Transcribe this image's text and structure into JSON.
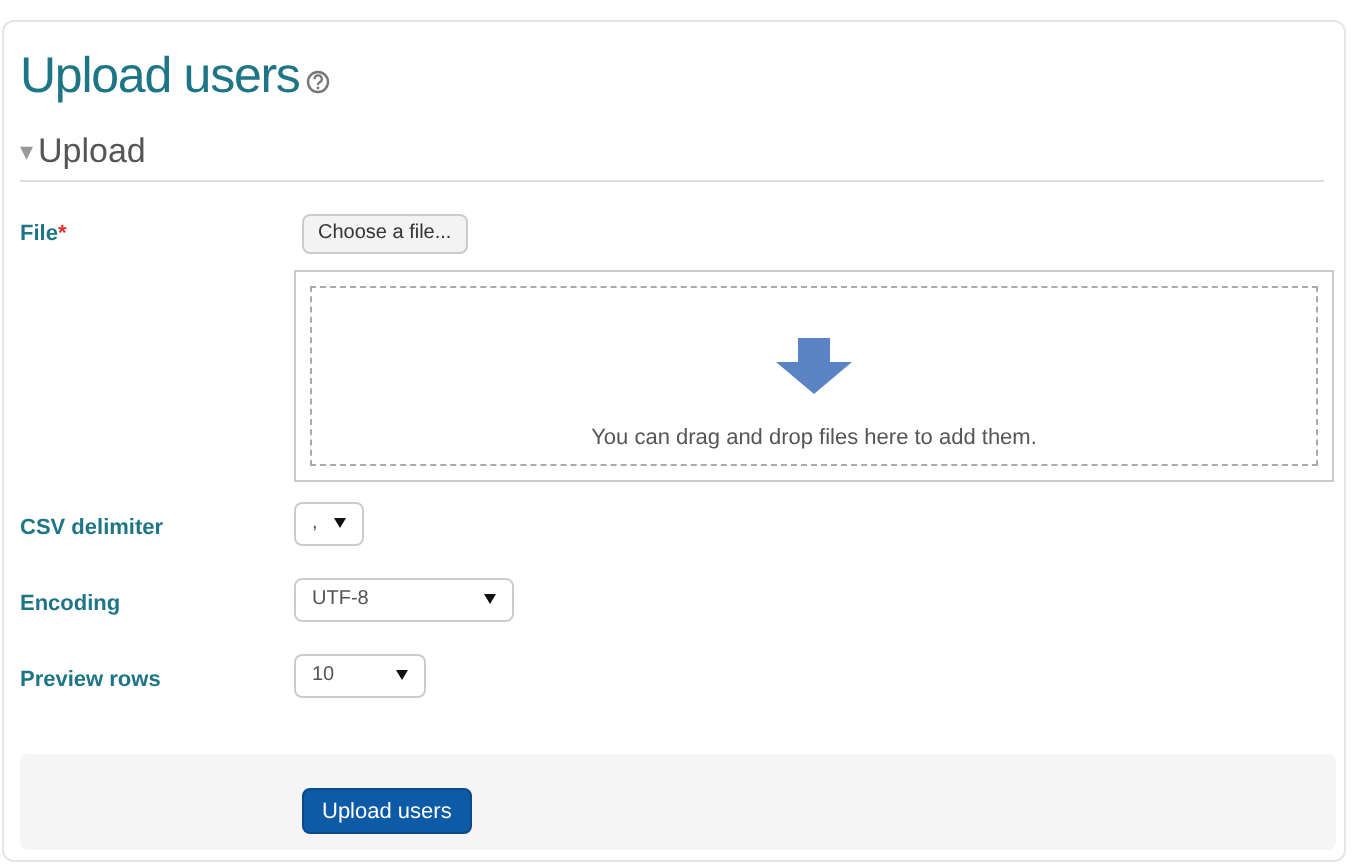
{
  "page_title": "Upload users",
  "section": {
    "toggle": "▾",
    "title": "Upload",
    "expanded": true
  },
  "fields": [
    {
      "kind": "file",
      "label": "File",
      "required_mark": "*",
      "button": "Choose a file...",
      "drop_hint": "You can drag and drop files here to add them."
    },
    {
      "kind": "select",
      "label": "CSV delimiter",
      "value": ","
    },
    {
      "kind": "select",
      "label": "Encoding",
      "value": "UTF-8"
    },
    {
      "kind": "select",
      "label": "Preview rows",
      "value": "10"
    }
  ],
  "submit": "Upload users"
}
